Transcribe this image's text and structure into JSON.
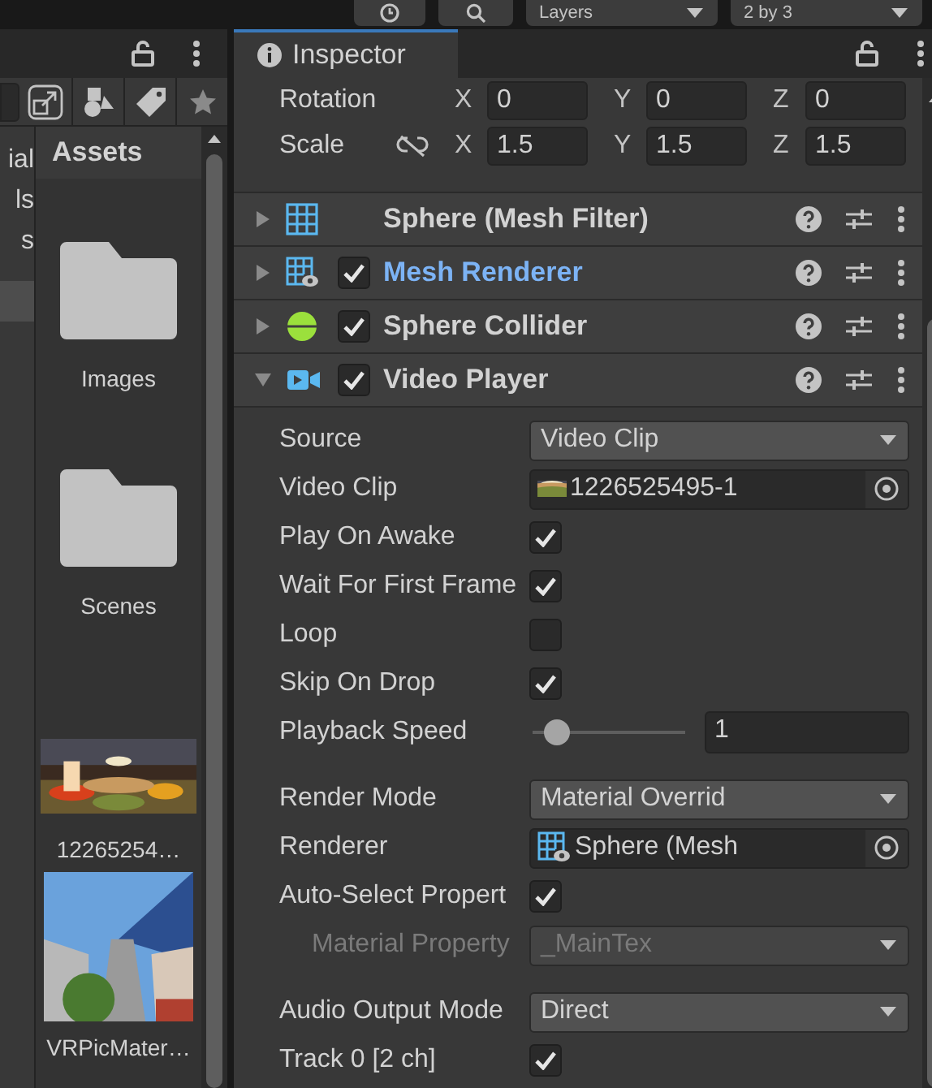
{
  "toolbar": {
    "layers": "Layers",
    "layout": "2 by 3"
  },
  "project": {
    "sidebar_items": [
      {
        "kind": "text",
        "label": "ial",
        "selected": false
      },
      {
        "kind": "text",
        "label": "ls",
        "selected": false
      },
      {
        "kind": "text",
        "label": "s",
        "selected": false
      },
      {
        "kind": "blank",
        "selected": true
      }
    ],
    "assets_title": "Assets",
    "assets": [
      {
        "kind": "folder",
        "label": "Images"
      },
      {
        "kind": "folder",
        "label": "Scenes"
      },
      {
        "kind": "picture",
        "label": "12265254…"
      },
      {
        "kind": "picture",
        "label": "VRPicMater…"
      }
    ]
  },
  "inspector": {
    "tab": "Inspector",
    "transform_rows": [
      {
        "label": "Rotation",
        "kind": "plain",
        "axes": [
          "X",
          "Y",
          "Z"
        ],
        "values": [
          "0",
          "0",
          "0"
        ]
      },
      {
        "label": "Scale",
        "kind": "linked",
        "axes": [
          "X",
          "Y",
          "Z"
        ],
        "values": [
          "1.5",
          "1.5",
          "1.5"
        ]
      }
    ],
    "components": [
      {
        "name": "Sphere (Mesh Filter)",
        "kind": "mesh_filter",
        "expanded": false,
        "selected": false
      },
      {
        "name": "Mesh Renderer",
        "kind": "mesh_renderer",
        "enabled": true,
        "expanded": false,
        "selected": true
      },
      {
        "name": "Sphere Collider",
        "kind": "collider",
        "enabled": true,
        "expanded": false,
        "selected": false
      },
      {
        "name": "Video Player",
        "kind": "video",
        "enabled": true,
        "expanded": true,
        "selected": false
      }
    ],
    "properties": [
      {
        "label": "Source",
        "kind": "dropdown",
        "value": "Video Clip"
      },
      {
        "label": "Video Clip",
        "kind": "clip_object",
        "value": "1226525495-1"
      },
      {
        "label": "Play On Awake",
        "kind": "checkbox",
        "checked": true
      },
      {
        "label": "Wait For First Frame",
        "kind": "checkbox",
        "checked": true
      },
      {
        "label": "Loop",
        "kind": "checkbox",
        "checked": false
      },
      {
        "label": "Skip On Drop",
        "kind": "checkbox",
        "checked": true
      },
      {
        "label": "Playback Speed",
        "kind": "slider",
        "level": 0.16,
        "value": "1"
      },
      {
        "label": "Render Mode",
        "kind": "dropdown",
        "value": "Material Overrid",
        "group_start": true
      },
      {
        "label": "Renderer",
        "kind": "renderer_object",
        "value": "Sphere (Mesh"
      },
      {
        "label": "Auto-Select Propert",
        "kind": "checkbox",
        "checked": true,
        "children": [
          {
            "label": "Material Property",
            "kind": "dropdown",
            "value": "_MainTex",
            "disabled": true
          }
        ]
      },
      {
        "label": "Audio Output Mode",
        "kind": "dropdown",
        "value": "Direct",
        "group_start": true
      },
      {
        "label": "Track 0 [2 ch]",
        "kind": "checkbox",
        "checked": true
      }
    ]
  }
}
